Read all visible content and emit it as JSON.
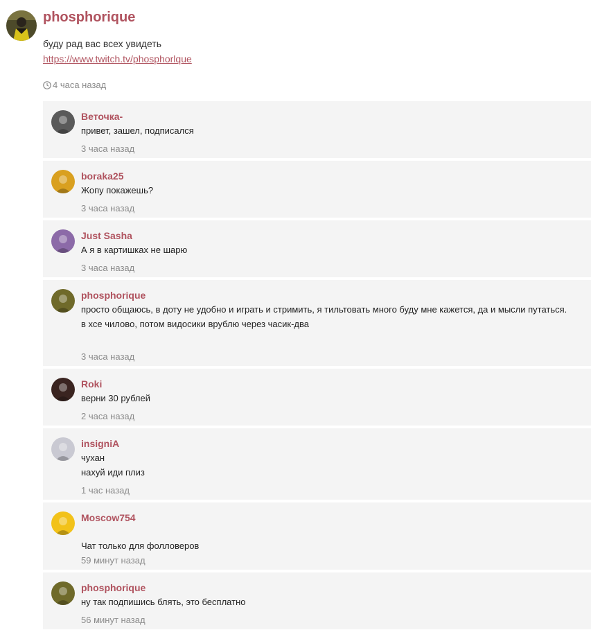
{
  "post": {
    "author": "phosphorique",
    "text": "буду рад вас всех увидеть",
    "link": "https://www.twitch.tv/phosphorlque",
    "time": "4 часа назад",
    "avatar_icon": "user-avatar-icon"
  },
  "comments": [
    {
      "author": "Веточка-",
      "lines": [
        "привет, зашел, подписался"
      ],
      "time": "3 часа назад",
      "avatar_color": "#5a5a5a"
    },
    {
      "author": "boraka25",
      "lines": [
        "Жопу покажешь?"
      ],
      "time": "3 часа назад",
      "avatar_color": "#d9a020"
    },
    {
      "author": "Just Sasha",
      "lines": [
        "А я в картишках не шарю"
      ],
      "time": "3 часа назад",
      "avatar_color": "#8c6aa8"
    },
    {
      "author": "phosphorique",
      "lines": [
        "просто общаюсь, в доту не удобно и играть и стримить, я тильтовать много буду мне кажется, да и мысли путаться.",
        "в хсе чиловo, потом видосики врублю через часик-два"
      ],
      "time": "3 часа назад",
      "avatar_color": "#6f6a2a"
    },
    {
      "author": "Roki",
      "lines": [
        "верни 30 рублей"
      ],
      "time": "2 часа назад",
      "avatar_color": "#3a2420"
    },
    {
      "author": "insigniA",
      "lines": [
        "чухан",
        "нахуй иди плиз"
      ],
      "time": "1 час назад",
      "avatar_color": "#c9c9d2"
    },
    {
      "author": "Moscow754",
      "lines": [
        "Чат только для фолловеров"
      ],
      "time": "59 минут назад",
      "avatar_color": "#f2c21a"
    },
    {
      "author": "phosphorique",
      "lines": [
        "ну так подпишись блять, это бесплатно"
      ],
      "time": "56 минут назад",
      "avatar_color": "#6f6a2a"
    }
  ]
}
